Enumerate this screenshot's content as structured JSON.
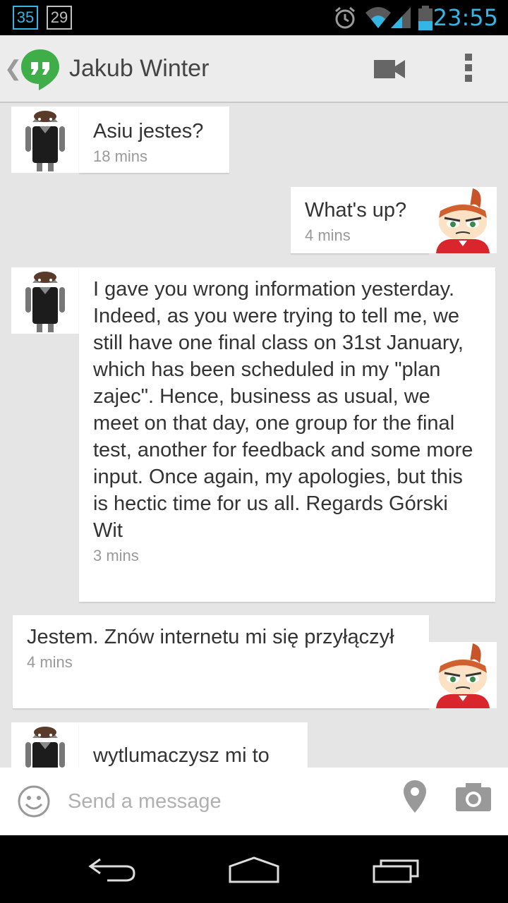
{
  "status_bar": {
    "badge_1": "35",
    "badge_2": "29",
    "time": "23:55",
    "icons": [
      "alarm-icon",
      "wifi-icon",
      "signal-icon",
      "battery-icon"
    ]
  },
  "header": {
    "contact_name": "Jakub Winter",
    "app_icon": "hangouts-icon",
    "actions": [
      "video-call-icon",
      "overflow-menu-icon"
    ]
  },
  "messages": [
    {
      "direction": "incoming",
      "text": "Asiu jestes?",
      "time": "18 mins"
    },
    {
      "direction": "outgoing",
      "text": "What's up?",
      "time": "4 mins"
    },
    {
      "direction": "incoming",
      "text": "I gave you wrong information yesterday. Indeed, as you were trying to tell me, we still have one final class on 31st January, which has been scheduled in my \"plan zajec\". Hence, business as usual, we meet on that day, one group for the final test, another for feedback and some more input. Once again, my apologies, but this is hectic time for us all. Regards Górski Wit",
      "time": "3 mins"
    },
    {
      "direction": "outgoing",
      "text": "Jestem. Znów internetu mi się przyłączył",
      "time": "4 mins"
    },
    {
      "direction": "incoming",
      "text": "wytlumaczysz mi to",
      "time": ""
    }
  ],
  "composer": {
    "placeholder": "Send a message",
    "value": "",
    "icons": [
      "smiley-icon",
      "location-pin-icon",
      "camera-icon"
    ]
  },
  "nav_bar": {
    "icons": [
      "back-icon",
      "home-icon",
      "recent-apps-icon"
    ]
  },
  "colors": {
    "accent": "#33b5e5",
    "hangouts_green": "#3fae49",
    "background": "#e5e5e5"
  }
}
